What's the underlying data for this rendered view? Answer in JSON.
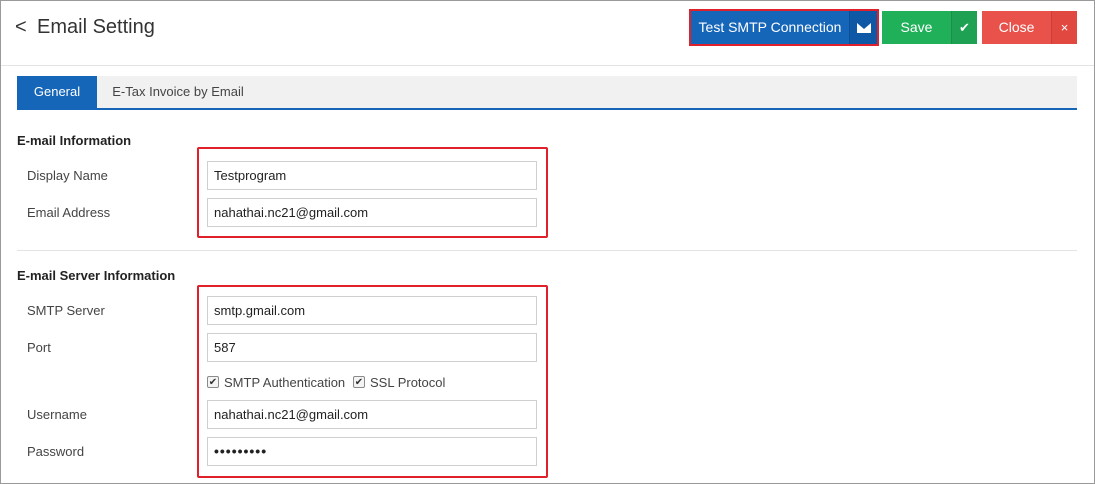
{
  "header": {
    "back_glyph": "<",
    "title": "Email Setting"
  },
  "toolbar": {
    "test_label": "Test SMTP Connection",
    "test_icon": "envelope-icon",
    "save_label": "Save",
    "save_icon": "check-icon",
    "save_icon_glyph": "✔",
    "close_label": "Close",
    "close_icon": "close-icon",
    "close_icon_glyph": "×"
  },
  "tabs": [
    {
      "label": "General",
      "active": true
    },
    {
      "label": "E-Tax Invoice by Email",
      "active": false
    }
  ],
  "email_info": {
    "title": "E-mail Information",
    "display_name_label": "Display Name",
    "display_name_value": "Testprogram",
    "email_label": "Email Address",
    "email_value": "nahathai.nc21@gmail.com"
  },
  "server_info": {
    "title": "E-mail Server Information",
    "smtp_label": "SMTP Server",
    "smtp_value": "smtp.gmail.com",
    "port_label": "Port",
    "port_value": "587",
    "smtp_auth_label": "SMTP Authentication",
    "smtp_auth_checked": true,
    "ssl_label": "SSL Protocol",
    "ssl_checked": true,
    "check_glyph": "✔",
    "username_label": "Username",
    "username_value": "nahathai.nc21@gmail.com",
    "password_label": "Password",
    "password_value": "•••••••••"
  },
  "colors": {
    "primary": "#1565b8",
    "success": "#21b05a",
    "danger": "#e8524a",
    "highlight": "#e0202a"
  }
}
